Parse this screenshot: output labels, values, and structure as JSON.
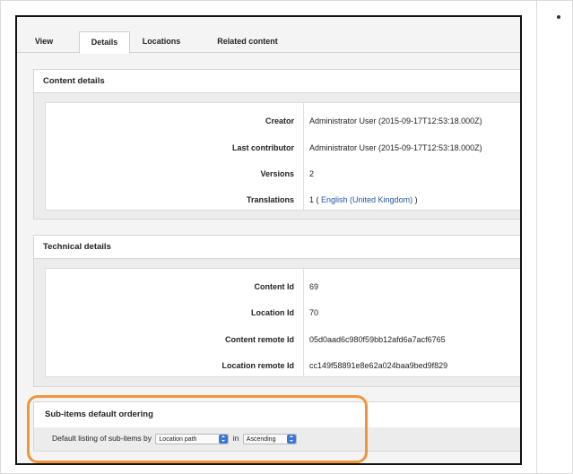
{
  "tabs": [
    {
      "label": "View"
    },
    {
      "label": "Details"
    },
    {
      "label": "Locations"
    },
    {
      "label": "Related content"
    }
  ],
  "active_tab": "Details",
  "content_details": {
    "title": "Content details",
    "rows": [
      {
        "label": "Creator",
        "value": "Administrator User (2015-09-17T12:53:18.000Z)"
      },
      {
        "label": "Last contributor",
        "value": "Administrator User (2015-09-17T12:53:18.000Z)"
      },
      {
        "label": "Versions",
        "value": "2"
      }
    ],
    "translations": {
      "label": "Translations",
      "prefix": "1 ( ",
      "link": "English (United Kingdom)",
      "suffix": " )"
    }
  },
  "technical_details": {
    "title": "Technical details",
    "rows": [
      {
        "label": "Content Id",
        "value": "69"
      },
      {
        "label": "Location Id",
        "value": "70"
      },
      {
        "label": "Content remote Id",
        "value": "05d0aad6c980f59bb12afd6a7acf6765"
      },
      {
        "label": "Location remote Id",
        "value": "cc149f58891e8e62a024baa9bed9f829"
      }
    ]
  },
  "sub_items": {
    "title": "Sub-items default ordering",
    "prefix": "Default listing of sub-items by",
    "sort_field": "Location path",
    "joiner": "in",
    "sort_order": "Ascending"
  },
  "colors": {
    "highlight": "#f0953a",
    "link": "#2255aa",
    "select_arrow": "#3a78d8"
  }
}
